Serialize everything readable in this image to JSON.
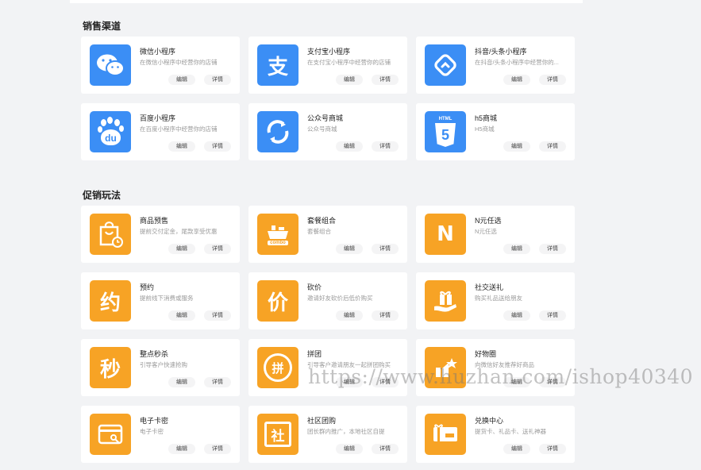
{
  "sections": {
    "channels": {
      "title": "销售渠道",
      "cards": [
        {
          "name": "微信小程序",
          "desc": "在微信小程序中经营你的店铺",
          "color": "#3b8ef5",
          "icon": "wechat-icon"
        },
        {
          "name": "支付宝小程序",
          "desc": "在支付宝小程序中经营你的店铺",
          "color": "#3b8ef5",
          "icon": "alipay-icon",
          "glyph": "支"
        },
        {
          "name": "抖音/头条小程序",
          "desc": "在抖音/头条小程序中经营你的...",
          "color": "#3b8ef5",
          "icon": "douyin-icon"
        },
        {
          "name": "百度小程序",
          "desc": "在百度小程序中经营你的店铺",
          "color": "#3b8ef5",
          "icon": "baidu-icon",
          "glyph": "du"
        },
        {
          "name": "公众号商城",
          "desc": "公众号商城",
          "color": "#3b8ef5",
          "icon": "official-account-icon"
        },
        {
          "name": "h5商城",
          "desc": "H5商城",
          "color": "#3b8ef5",
          "icon": "html5-icon",
          "glyph": "5",
          "glyph_label": "HTML"
        }
      ]
    },
    "promotions": {
      "title": "促销玩法",
      "cards": [
        {
          "name": "商品预售",
          "desc": "提前交付定金，尾款享受优惠",
          "color": "#f7a325",
          "icon": "presale-bag-icon"
        },
        {
          "name": "套餐组合",
          "desc": "套餐组合",
          "color": "#f7a325",
          "icon": "combo-icon",
          "glyph": "combo"
        },
        {
          "name": "N元任选",
          "desc": "N元任选",
          "color": "#f7a325",
          "icon": "n-yuan-icon",
          "glyph": "N"
        },
        {
          "name": "预约",
          "desc": "提前线下消费或服务",
          "color": "#f7a325",
          "icon": "reservation-icon",
          "glyph": "约"
        },
        {
          "name": "砍价",
          "desc": "邀请好友砍价后低价购买",
          "color": "#f7a325",
          "icon": "bargain-icon",
          "glyph": "价"
        },
        {
          "name": "社交送礼",
          "desc": "购买礼品送给朋友",
          "color": "#f7a325",
          "icon": "gift-icon"
        },
        {
          "name": "整点秒杀",
          "desc": "引导客户快速抢购",
          "color": "#f7a325",
          "icon": "flash-sale-icon",
          "glyph": "秒"
        },
        {
          "name": "拼团",
          "desc": "引导客户邀请朋友一起拼团购买",
          "color": "#f7a325",
          "icon": "group-buy-icon",
          "glyph": "拼"
        },
        {
          "name": "好物圈",
          "desc": "向微信好友推荐好商品",
          "color": "#f7a325",
          "icon": "good-items-icon"
        },
        {
          "name": "电子卡密",
          "desc": "电子卡密",
          "color": "#f7a325",
          "icon": "e-card-icon"
        },
        {
          "name": "社区团购",
          "desc": "团长群内推广，本地社区自提",
          "color": "#f7a325",
          "icon": "community-icon",
          "glyph": "社"
        },
        {
          "name": "兑换中心",
          "desc": "提货卡、礼品卡、送礼神器",
          "color": "#f7a325",
          "icon": "exchange-icon"
        }
      ]
    }
  },
  "buttons": {
    "edit": "编辑",
    "detail": "详情"
  },
  "watermark": "https://www.huzhan.com/ishop40340"
}
